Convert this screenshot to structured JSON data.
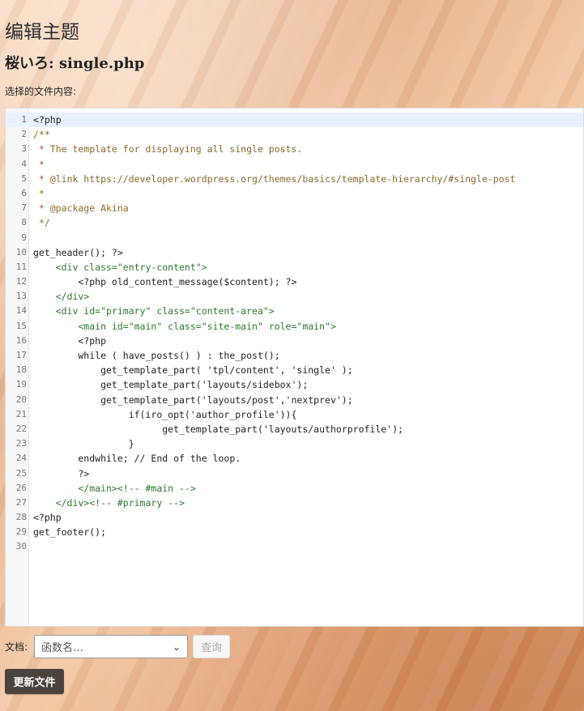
{
  "page": {
    "title": "编辑主题",
    "file_title": "桜いろ: single.php",
    "selected_label": "选择的文件内容:"
  },
  "editor": {
    "lines": [
      {
        "n": "1",
        "text": "<?php"
      },
      {
        "n": "2",
        "text": "/**"
      },
      {
        "n": "3",
        "text": " * The template for displaying all single posts."
      },
      {
        "n": "4",
        "text": " *"
      },
      {
        "n": "5",
        "text": " * @link https://developer.wordpress.org/themes/basics/template-hierarchy/#single-post"
      },
      {
        "n": "6",
        "text": " *"
      },
      {
        "n": "7",
        "text": " * @package Akina"
      },
      {
        "n": "8",
        "text": " */"
      },
      {
        "n": "9",
        "text": ""
      },
      {
        "n": "10",
        "text": "get_header(); ?>"
      },
      {
        "n": "11",
        "text": "    <div class=\"entry-content\">"
      },
      {
        "n": "12",
        "text": "        <?php old_content_message($content); ?>"
      },
      {
        "n": "13",
        "text": "    </div>"
      },
      {
        "n": "14",
        "text": "    <div id=\"primary\" class=\"content-area\">"
      },
      {
        "n": "15",
        "text": "        <main id=\"main\" class=\"site-main\" role=\"main\">"
      },
      {
        "n": "16",
        "text": "        <?php"
      },
      {
        "n": "17",
        "text": "        while ( have_posts() ) : the_post();"
      },
      {
        "n": "18",
        "text": "            get_template_part( 'tpl/content', 'single' );"
      },
      {
        "n": "19",
        "text": "            get_template_part('layouts/sidebox');"
      },
      {
        "n": "20",
        "text": "            get_template_part('layouts/post','nextprev');"
      },
      {
        "n": "21",
        "text": "                 if(iro_opt('author_profile')){"
      },
      {
        "n": "22",
        "text": "                       get_template_part('layouts/authorprofile');"
      },
      {
        "n": "23",
        "text": "                 }"
      },
      {
        "n": "24",
        "text": "        endwhile; // End of the loop."
      },
      {
        "n": "25",
        "text": "        ?>"
      },
      {
        "n": "26",
        "text": "        </main><!-- #main -->"
      },
      {
        "n": "27",
        "text": "    </div><!-- #primary -->"
      },
      {
        "n": "28",
        "text": "<?php"
      },
      {
        "n": "29",
        "text": "get_footer();"
      },
      {
        "n": "30",
        "text": ""
      }
    ]
  },
  "docs": {
    "label": "文档:",
    "select_value": "函数名…",
    "query_label": "查询"
  },
  "update_label": "更新文件",
  "colors": {
    "button_bg": "#4a433d",
    "active_line": "#e8f2fe",
    "comment": "#8a6a2a",
    "tag": "#2a7a2a",
    "string": "#b43a1e"
  }
}
